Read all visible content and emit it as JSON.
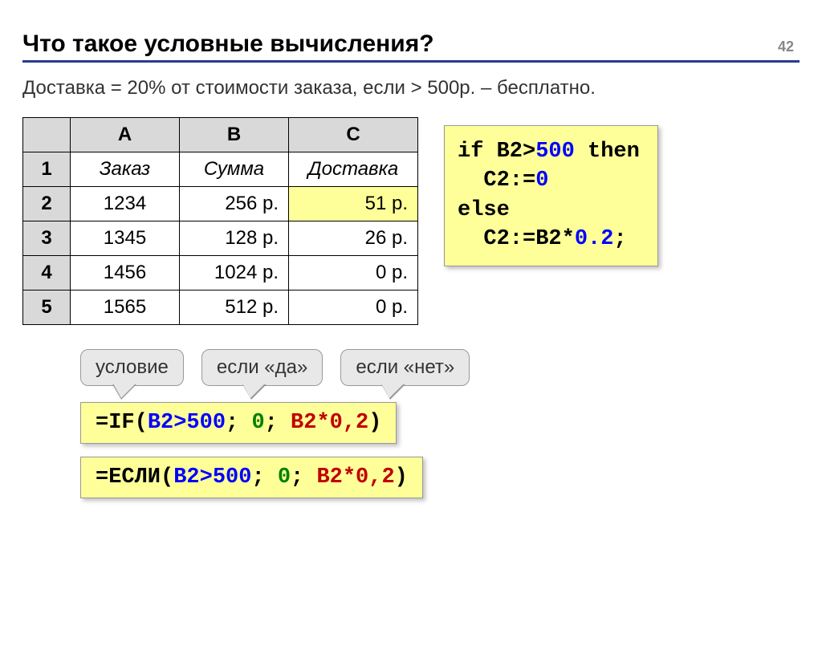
{
  "page_number": "42",
  "title": "Что такое условные вычисления?",
  "description": "Доставка = 20% от стоимости заказа, если > 500р. – бесплатно.",
  "table": {
    "cols": [
      "A",
      "B",
      "C"
    ],
    "row_nums": [
      "1",
      "2",
      "3",
      "4",
      "5"
    ],
    "headers": [
      "Заказ",
      "Сумма",
      "Доставка"
    ],
    "rows": [
      [
        "1234",
        "256 р.",
        "51 р."
      ],
      [
        "1345",
        "128 р.",
        "26 р."
      ],
      [
        "1456",
        "1024 р.",
        "0 р."
      ],
      [
        "1565",
        "512 р.",
        "0 р."
      ]
    ]
  },
  "code": {
    "if": "if",
    "cond_l": " B2>",
    "cond_n": "500",
    "then": " then",
    "assign1_l": "  C2:=",
    "assign1_n": "0",
    "else": "else",
    "assign2_l": "  C2:=B2*",
    "assign2_n": "0.2",
    "semi": ";"
  },
  "callouts": {
    "c1": "условие",
    "c2": "если «да»",
    "c3": "если «нет»"
  },
  "formula1": {
    "pre": "=IF(",
    "cond": "B2>500",
    "sep1": "; ",
    "yes": "0",
    "sep2": "; ",
    "no": "B2*0,2",
    "post": ")"
  },
  "formula2": {
    "pre": "=ЕСЛИ(",
    "cond": "B2>500",
    "sep1": "; ",
    "yes": "0",
    "sep2": "; ",
    "no": "B2*0,2",
    "post": ")"
  }
}
